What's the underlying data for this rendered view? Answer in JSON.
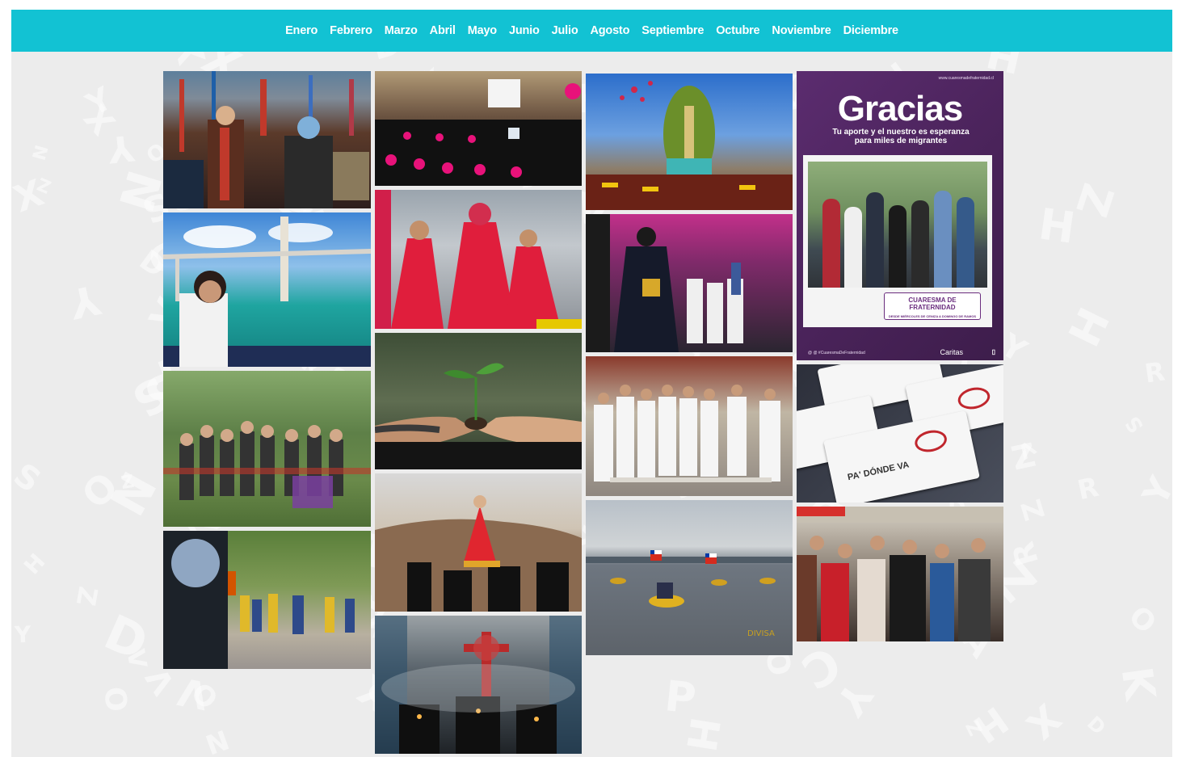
{
  "nav": {
    "months": [
      "Enero",
      "Febrero",
      "Marzo",
      "Abril",
      "Mayo",
      "Junio",
      "Julio",
      "Agosto",
      "Septiembre",
      "Octubre",
      "Noviembre",
      "Diciembre"
    ]
  },
  "colors": {
    "nav_bg": "#12c2d3",
    "nav_text": "#ffffff",
    "page_bg": "#ececec"
  },
  "gallery": {
    "poster": {
      "url": "www.cuaresmadefraternidad.cl",
      "title": "Gracias",
      "subtitle_line1": "Tu aporte y el nuestro es esperanza",
      "subtitle_line2": "para miles de migrantes",
      "label_main": "CUARESMA DE FRATERNIDAD",
      "label_small": "DESDE MIÉRCOLES DE CENIZA A DOMINGO DE RAMOS",
      "footer_left": "@ @ #CuaresmaDeFraternidad",
      "footer_logo": "Caritas"
    },
    "cards": {
      "text": "PA' DÓNDE VA"
    },
    "boats_watermark": "DIVISA"
  }
}
